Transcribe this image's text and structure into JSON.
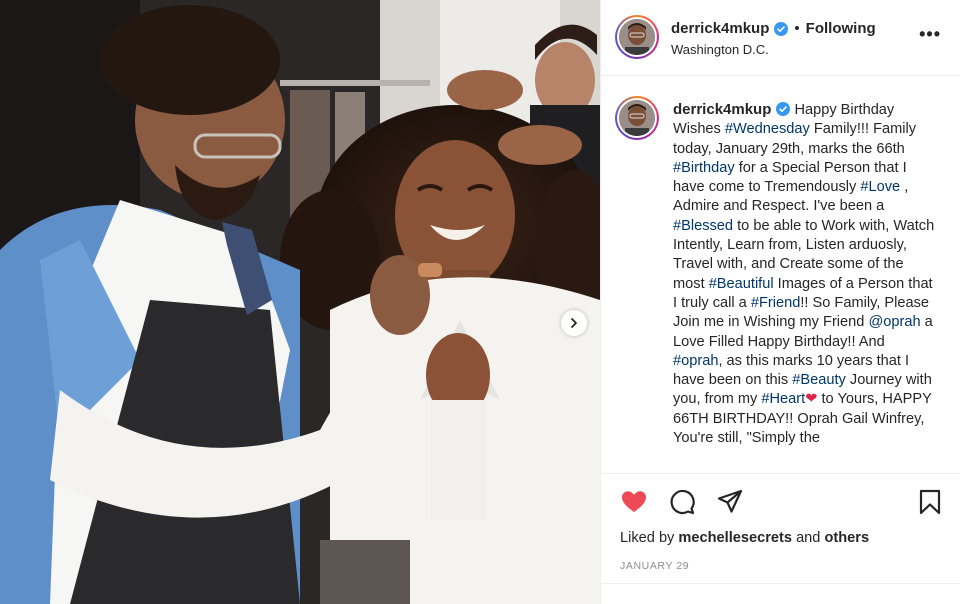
{
  "post": {
    "username": "derrick4mkup",
    "following_label": "Following",
    "separator": "•",
    "location": "Washington D.C.",
    "more_label": "•••"
  },
  "caption": {
    "username": "derrick4mkup",
    "segments": [
      {
        "type": "text",
        "value": " Happy Birthday Wishes "
      },
      {
        "type": "tag",
        "value": "#Wednesday"
      },
      {
        "type": "text",
        "value": " Family!!! Family today, January 29th, marks the 66th "
      },
      {
        "type": "tag",
        "value": "#Birthday"
      },
      {
        "type": "text",
        "value": " for a Special Person that I have come to Tremendously "
      },
      {
        "type": "tag",
        "value": "#Love"
      },
      {
        "type": "text",
        "value": " , Admire and Respect. I've been a "
      },
      {
        "type": "tag",
        "value": "#Blessed"
      },
      {
        "type": "text",
        "value": " to be able to Work with, Watch Intently, Learn from, Listen arduosly, Travel with, and Create some of the most "
      },
      {
        "type": "tag",
        "value": "#Beautiful"
      },
      {
        "type": "text",
        "value": " Images of a Person that I truly call a "
      },
      {
        "type": "tag",
        "value": "#Friend"
      },
      {
        "type": "text",
        "value": "!! So Family,  Please Join me in Wishing my Friend "
      },
      {
        "type": "tag",
        "value": "@oprah"
      },
      {
        "type": "text",
        "value": " a Love Filled Happy Birthday!! And "
      },
      {
        "type": "tag",
        "value": "#oprah"
      },
      {
        "type": "text",
        "value": ", as this marks 10 years that I have been on this "
      },
      {
        "type": "tag",
        "value": "#Beauty"
      },
      {
        "type": "text",
        "value": " Journey with you, from my "
      },
      {
        "type": "tag",
        "value": "#Heart"
      },
      {
        "type": "heart",
        "value": "❤"
      },
      {
        "type": "text",
        "value": " to Yours, HAPPY 66TH BIRTHDAY!! Oprah Gail Winfrey, You're still, \"Simply the"
      }
    ]
  },
  "engagement": {
    "liked_prefix": "Liked by ",
    "liked_user": "mechellesecrets",
    "liked_and": " and ",
    "liked_others": "others",
    "date": "JANUARY 29"
  },
  "icons": {
    "like": "heart-filled-icon",
    "comment": "comment-icon",
    "share": "paper-plane-icon",
    "save": "bookmark-icon",
    "verified": "verified-badge-icon",
    "next": "chevron-right-icon"
  },
  "colors": {
    "like_red": "#ed4956",
    "verified_blue": "#3897f0",
    "hashtag_blue": "#00376b",
    "text": "#262626",
    "muted": "#8e8e8e"
  }
}
